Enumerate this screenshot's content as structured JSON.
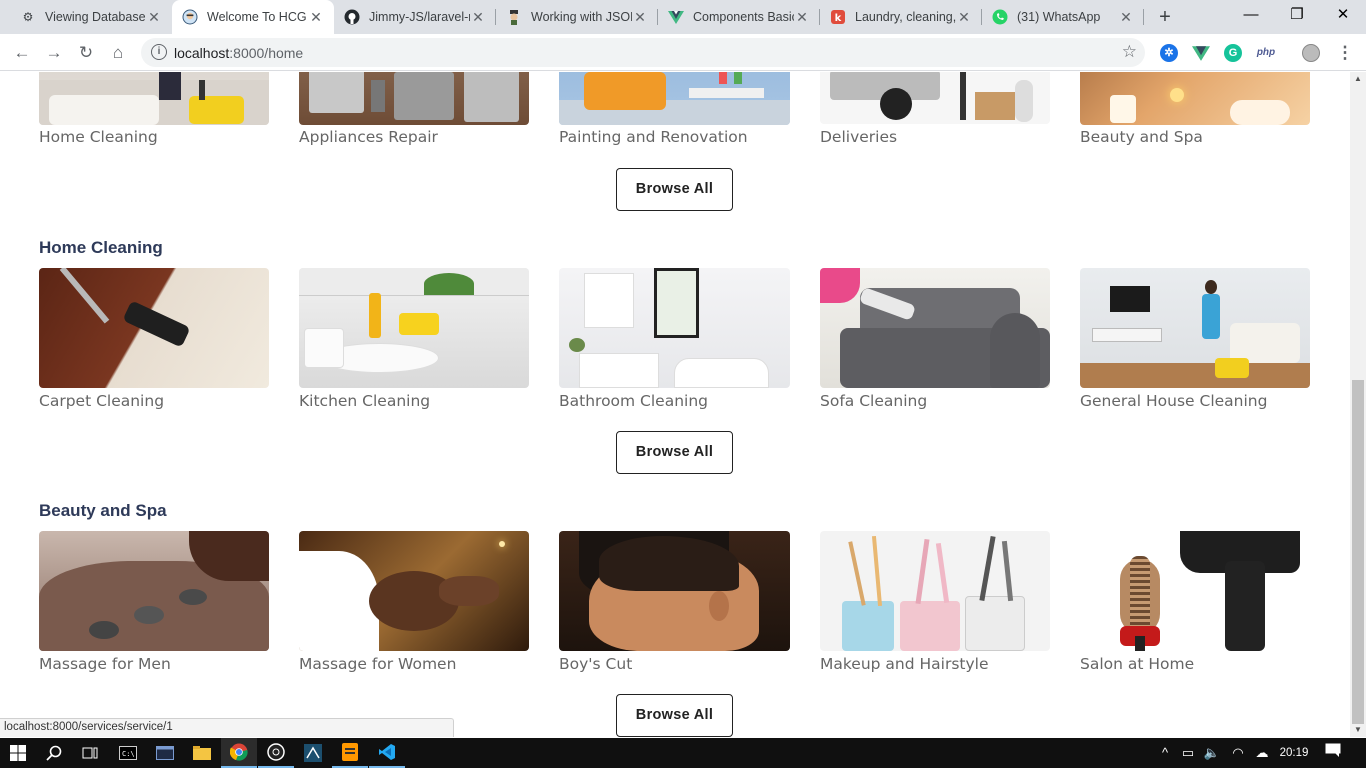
{
  "browser": {
    "tabs": [
      {
        "title": "Viewing Database",
        "icon": "gear-icon"
      },
      {
        "title": "Welcome To HCG",
        "icon": "avatar-icon",
        "active": true
      },
      {
        "title": "Jimmy-JS/laravel-r",
        "icon": "github-icon"
      },
      {
        "title": "Working with JSON",
        "icon": "mascot-icon"
      },
      {
        "title": "Components Basic",
        "icon": "vue-icon"
      },
      {
        "title": "Laundry, cleaning,",
        "icon": "service-icon"
      },
      {
        "title": "(31) WhatsApp",
        "icon": "whatsapp-icon"
      }
    ],
    "url_host": "localhost",
    "url_path": ":8000/home",
    "extensions": [
      "php"
    ],
    "status_url": "localhost:8000/services/service/1"
  },
  "page": {
    "top_row": [
      {
        "caption": "Home Cleaning",
        "scene": "vacuum"
      },
      {
        "caption": "Appliances Repair",
        "scene": "appliances"
      },
      {
        "caption": "Painting and Renovation",
        "scene": "sofa-room"
      },
      {
        "caption": "Deliveries",
        "scene": "trolley"
      },
      {
        "caption": "Beauty and Spa",
        "scene": "candles"
      }
    ],
    "browse_label": "Browse All",
    "sections": [
      {
        "title": "Home Cleaning",
        "items": [
          {
            "caption": "Carpet Cleaning",
            "scene": "carpet"
          },
          {
            "caption": "Kitchen Cleaning",
            "scene": "kitchen"
          },
          {
            "caption": "Bathroom Cleaning",
            "scene": "bathroom"
          },
          {
            "caption": "Sofa Cleaning",
            "scene": "sofa"
          },
          {
            "caption": "General House Cleaning",
            "scene": "living-room"
          }
        ]
      },
      {
        "title": "Beauty and Spa",
        "items": [
          {
            "caption": "Massage for Men",
            "scene": "stone-massage"
          },
          {
            "caption": "Massage for Women",
            "scene": "face-massage"
          },
          {
            "caption": "Boy's Cut",
            "scene": "haircut"
          },
          {
            "caption": "Makeup and Hairstyle",
            "scene": "brushes"
          },
          {
            "caption": "Salon at Home",
            "scene": "hairdryer"
          }
        ]
      }
    ]
  },
  "taskbar": {
    "clock": "20:19"
  }
}
